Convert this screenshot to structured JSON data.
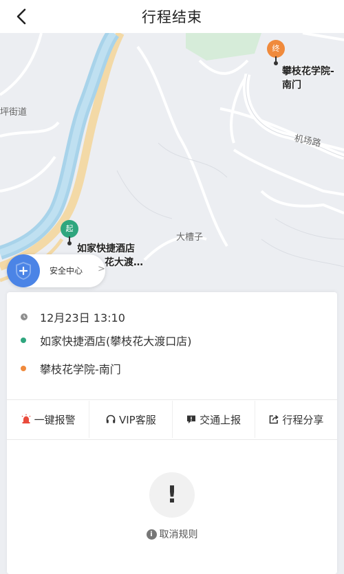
{
  "header": {
    "title": "行程结束"
  },
  "map": {
    "street_label": "坪街道",
    "road_label": "机场路",
    "area_label": "大槽子",
    "start_pin_text": "起",
    "end_pin_text": "终",
    "start_poi": "如家快捷酒店",
    "start_poi_line2": "花大渡…",
    "end_poi": "攀枝花学院-",
    "end_poi_line2": "南门"
  },
  "safety": {
    "label": "安全中心",
    "chevron": ">"
  },
  "trip": {
    "time": "12月23日 13:10",
    "origin": "如家快捷酒店(攀枝花大渡口店)",
    "destination": "攀枝花学院-南门"
  },
  "actions": [
    {
      "label": "一键报警",
      "icon": "alarm-icon"
    },
    {
      "label": "VIP客服",
      "icon": "headset-icon"
    },
    {
      "label": "交通上报",
      "icon": "report-icon"
    },
    {
      "label": "行程分享",
      "icon": "share-icon"
    }
  ],
  "alert": {
    "symbol": "!"
  },
  "cancel_rule": {
    "icon_text": "i",
    "label": "取消规则"
  },
  "colors": {
    "start_green": "#2fa67e",
    "end_orange": "#f08a3c",
    "safety_blue": "#4b84e6",
    "alarm_red": "#e94b3c",
    "river_blue": "#a8d3ea",
    "road_tan": "#f3d9a6"
  }
}
